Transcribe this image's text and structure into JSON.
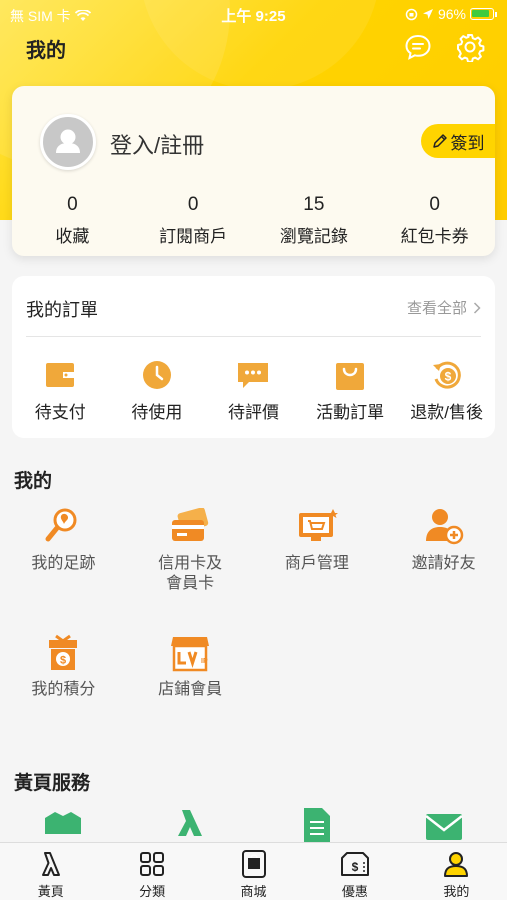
{
  "status_bar": {
    "carrier": "無 SIM 卡",
    "time": "上午 9:25",
    "battery": "96%"
  },
  "header": {
    "title": "我的"
  },
  "profile": {
    "login_label": "登入/註冊",
    "checkin_label": "簽到",
    "stats": [
      {
        "value": "0",
        "label": "收藏"
      },
      {
        "value": "0",
        "label": "訂閱商戶"
      },
      {
        "value": "15",
        "label": "瀏覽記錄"
      },
      {
        "value": "0",
        "label": "紅包卡券"
      }
    ]
  },
  "orders": {
    "title": "我的訂單",
    "view_all": "查看全部",
    "items": [
      {
        "label": "待支付",
        "icon": "wallet-icon"
      },
      {
        "label": "待使用",
        "icon": "clock-icon"
      },
      {
        "label": "待評價",
        "icon": "comment-icon"
      },
      {
        "label": "活動訂單",
        "icon": "shopping-bag-icon"
      },
      {
        "label": "退款/售後",
        "icon": "refund-icon"
      }
    ]
  },
  "mine": {
    "title": "我的",
    "items": [
      {
        "label": "我的足跡",
        "icon": "footprint-search-icon"
      },
      {
        "label": "信用卡及\n會員卡",
        "icon": "credit-card-icon"
      },
      {
        "label": "商戶管理",
        "icon": "merchant-monitor-icon"
      },
      {
        "label": "邀請好友",
        "icon": "invite-friend-icon"
      },
      {
        "label": "我的積分",
        "icon": "points-gift-icon"
      },
      {
        "label": "店鋪會員",
        "icon": "store-member-icon"
      }
    ]
  },
  "yellow_pages": {
    "title": "黃頁服務"
  },
  "tabbar": {
    "items": [
      {
        "label": "黃頁",
        "icon": "yellow-pages-icon"
      },
      {
        "label": "分類",
        "icon": "grid-icon"
      },
      {
        "label": "商城",
        "icon": "mall-icon"
      },
      {
        "label": "優惠",
        "icon": "coupon-icon"
      },
      {
        "label": "我的",
        "icon": "user-icon",
        "active": true
      }
    ]
  },
  "colors": {
    "brand_yellow": "#ffd400",
    "icon_orange": "#f08a24",
    "icon_amber": "#f0a83a"
  }
}
